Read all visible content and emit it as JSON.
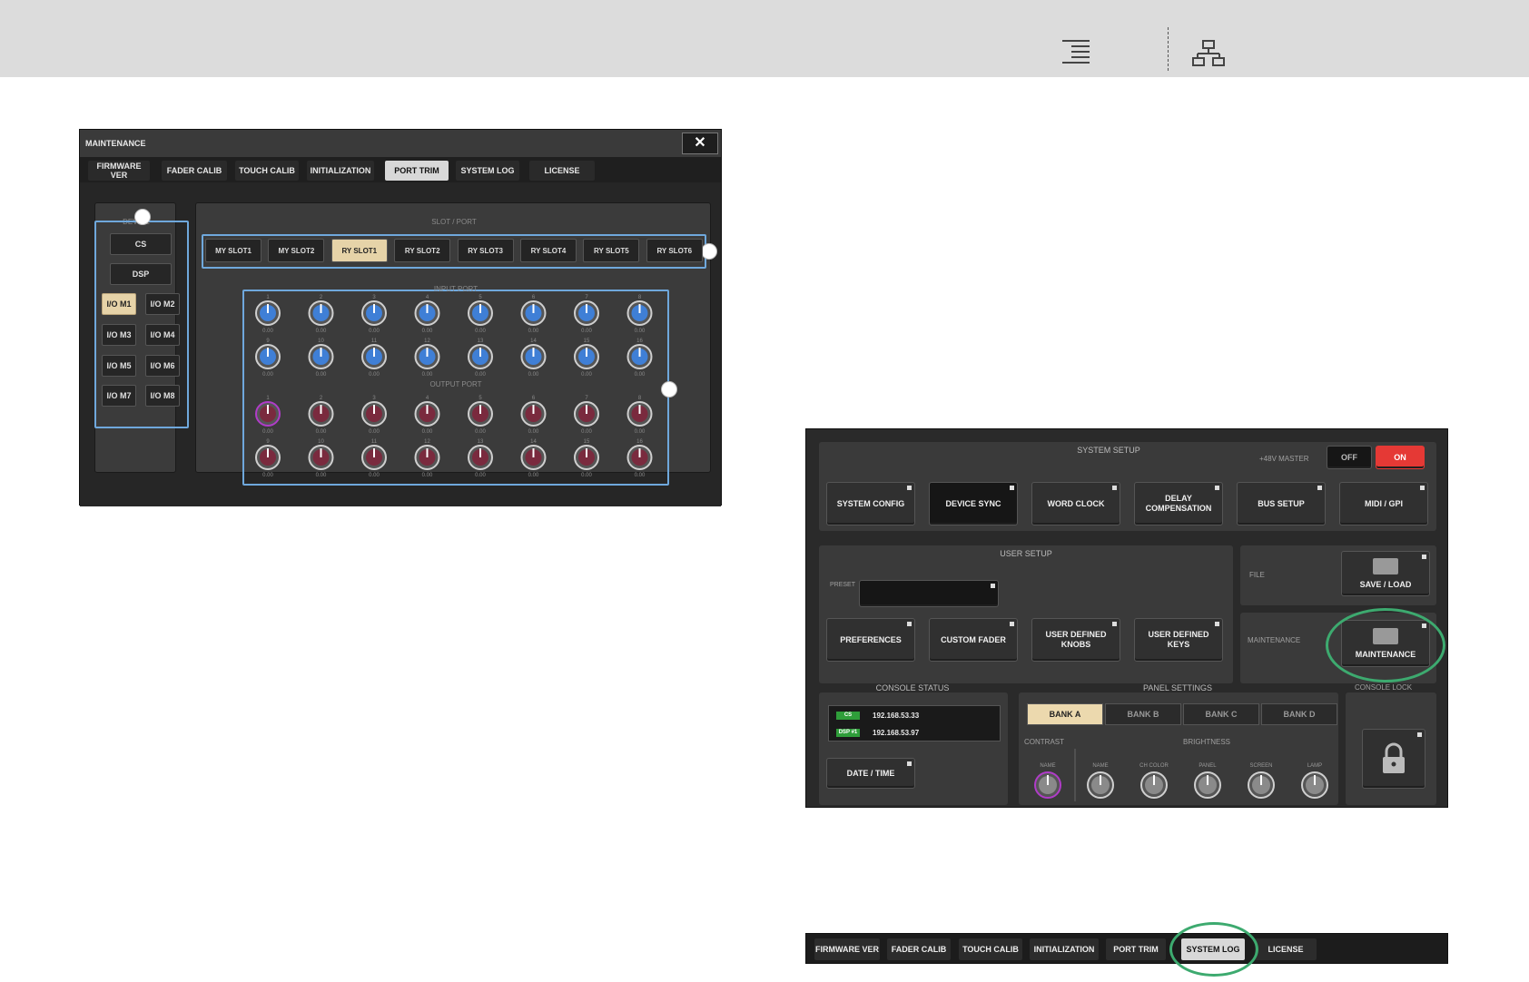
{
  "maintenance": {
    "title": "MAINTENANCE",
    "close_label": "✕",
    "tabs": [
      "FIRMWARE VER",
      "FADER CALIB",
      "TOUCH CALIB",
      "INITIALIZATION",
      "PORT TRIM",
      "SYSTEM LOG",
      "LICENSE"
    ],
    "active_tab": "PORT TRIM",
    "device_label": "DEVICE",
    "device_buttons": [
      "CS",
      "DSP"
    ],
    "io_buttons": [
      "I/O M1",
      "I/O M2",
      "I/O M3",
      "I/O M4",
      "I/O M5",
      "I/O M6",
      "I/O M7",
      "I/O M8"
    ],
    "active_io": "I/O M1",
    "slot_port_label": "SLOT / PORT",
    "slots": [
      "MY SLOT1",
      "MY SLOT2",
      "RY SLOT1",
      "RY SLOT2",
      "RY SLOT3",
      "RY SLOT4",
      "RY SLOT5",
      "RY SLOT6"
    ],
    "active_slot": "RY SLOT1",
    "input_port_label": "INPUT PORT",
    "output_port_label": "OUTPUT PORT",
    "knob_value": "0.00",
    "port_numbers_row1": [
      "1",
      "2",
      "3",
      "4",
      "5",
      "6",
      "7",
      "8"
    ],
    "port_numbers_row2": [
      "9",
      "10",
      "11",
      "12",
      "13",
      "14",
      "15",
      "16"
    ]
  },
  "system_setup": {
    "title": "SYSTEM SETUP",
    "phantom_label": "+48V MASTER",
    "phantom_off": "OFF",
    "phantom_on": "ON",
    "buttons": [
      "SYSTEM CONFIG",
      "DEVICE SYNC",
      "WORD CLOCK",
      "DELAY COMPENSATION",
      "BUS SETUP",
      "MIDI / GPI"
    ],
    "user_setup_title": "USER SETUP",
    "preset_label": "PRESET",
    "user_buttons": [
      "PREFERENCES",
      "CUSTOM FADER",
      "USER DEFINED KNOBS",
      "USER DEFINED KEYS"
    ],
    "file_label": "FILE",
    "save_load_label": "SAVE / LOAD",
    "maintenance_label": "MAINTENANCE",
    "maintenance_btn_label": "MAINTENANCE",
    "console_status_title": "CONSOLE STATUS",
    "ip_rows": [
      {
        "tag": "CS",
        "ip": "192.168.53.33"
      },
      {
        "tag": "DSP #1",
        "ip": "192.168.53.97"
      }
    ],
    "date_time_label": "DATE / TIME",
    "panel_settings_title": "PANEL SETTINGS",
    "banks": [
      "BANK A",
      "BANK B",
      "BANK C",
      "BANK D"
    ],
    "active_bank": "BANK A",
    "contrast_label": "CONTRAST",
    "brightness_label": "BRIGHTNESS",
    "knob_labels": [
      "NAME",
      "NAME",
      "CH COLOR",
      "PANEL",
      "SCREEN",
      "LAMP"
    ],
    "console_lock_title": "CONSOLE LOCK"
  },
  "bottom_tabs": {
    "tabs": [
      "FIRMWARE VER",
      "FADER CALIB",
      "TOUCH CALIB",
      "INITIALIZATION",
      "PORT TRIM",
      "SYSTEM LOG",
      "LICENSE"
    ],
    "active_tab": "SYSTEM LOG"
  },
  "colors": {
    "highlight_blue": "#6fa8dc",
    "highlight_green": "#3daa6f",
    "active_button": "#e6d3a8",
    "phantom_on": "#e53935"
  },
  "icons": {
    "toc": "list-indent-icon",
    "sitemap": "sitemap-icon"
  }
}
